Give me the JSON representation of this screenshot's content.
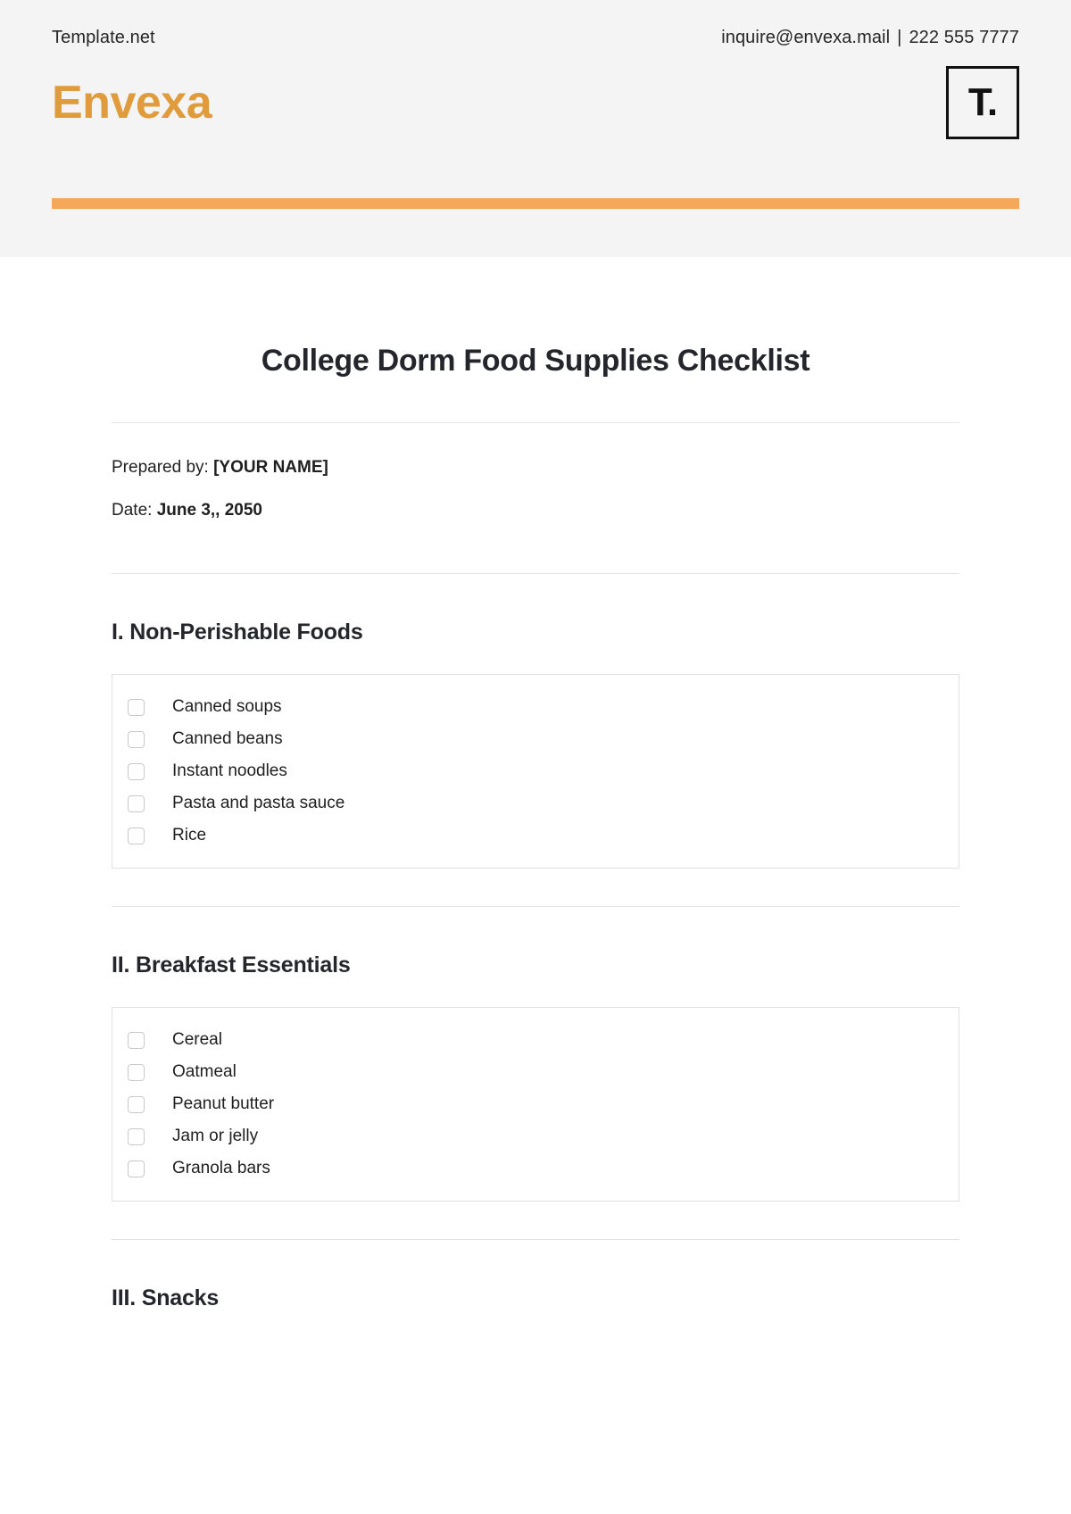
{
  "header": {
    "site_name": "Template.net",
    "email": "inquire@envexa.mail",
    "separator": "|",
    "phone": "222 555 7777",
    "brand_wordmark": "Envexa",
    "logo_glyph": "T.",
    "accent_color": "#f5a85a",
    "wordmark_color": "#e09b3d",
    "band_color": "#f4f4f4"
  },
  "document": {
    "title": "College Dorm Food Supplies Checklist",
    "meta": [
      {
        "label": "Prepared by:",
        "value": "[YOUR NAME]"
      },
      {
        "label": "Date:",
        "value": "June 3,, 2050"
      }
    ],
    "sections": [
      {
        "heading": "I. Non-Perishable Foods",
        "items": [
          "Canned soups",
          "Canned beans",
          "Instant noodles",
          "Pasta and pasta sauce",
          "Rice"
        ]
      },
      {
        "heading": "II. Breakfast Essentials",
        "items": [
          "Cereal",
          "Oatmeal",
          "Peanut butter",
          "Jam or jelly",
          "Granola bars"
        ]
      },
      {
        "heading": "III. Snacks",
        "items": []
      }
    ]
  }
}
